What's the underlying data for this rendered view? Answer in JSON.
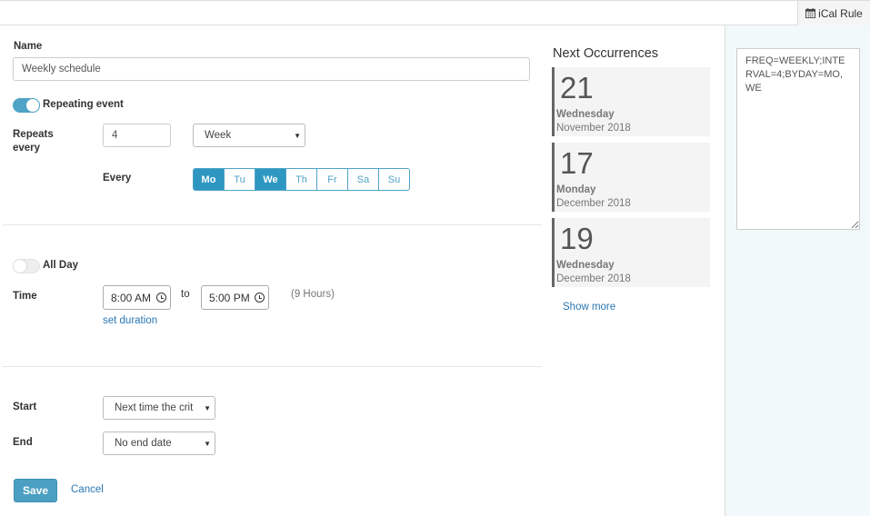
{
  "toolbar": {
    "ical_label": "iCal Rule",
    "ical_icon": "calendar-icon"
  },
  "form": {
    "name_label": "Name",
    "name_value": "Weekly schedule",
    "repeating_label": "Repeating event",
    "repeating_on": true,
    "repeats_every_label_1": "Repeats",
    "repeats_every_label_2": "every",
    "interval_value": "4",
    "frequency_value": "Week",
    "every_label": "Every",
    "days": [
      {
        "label": "Mo",
        "selected": true
      },
      {
        "label": "Tu",
        "selected": false
      },
      {
        "label": "We",
        "selected": true
      },
      {
        "label": "Th",
        "selected": false
      },
      {
        "label": "Fr",
        "selected": false
      },
      {
        "label": "Sa",
        "selected": false
      },
      {
        "label": "Su",
        "selected": false
      }
    ],
    "all_day_label": "All Day",
    "all_day_on": false,
    "time_label": "Time",
    "start_time": "8:00 AM",
    "to_label": "to",
    "end_time": "5:00 PM",
    "duration_text": "(9 Hours)",
    "set_duration_link": "set duration",
    "start_label": "Start",
    "start_value": "Next time the crit",
    "end_label": "End",
    "end_value": "No end date",
    "save_label": "Save",
    "cancel_label": "Cancel"
  },
  "occurrences": {
    "title": "Next Occurrences",
    "items": [
      {
        "day": "21",
        "weekday": "Wednesday",
        "month_year": "November 2018"
      },
      {
        "day": "17",
        "weekday": "Monday",
        "month_year": "December 2018"
      },
      {
        "day": "19",
        "weekday": "Wednesday",
        "month_year": "December 2018"
      }
    ],
    "show_more": "Show more"
  },
  "ical": {
    "rule_text": "FREQ=WEEKLY;INTERVAL=4;BYDAY=MO,WE"
  },
  "colors": {
    "accent": "#4fa3c7",
    "selected_day": "#2d97c2",
    "link": "#2a77b5",
    "side_bg": "#f2f9fa"
  }
}
